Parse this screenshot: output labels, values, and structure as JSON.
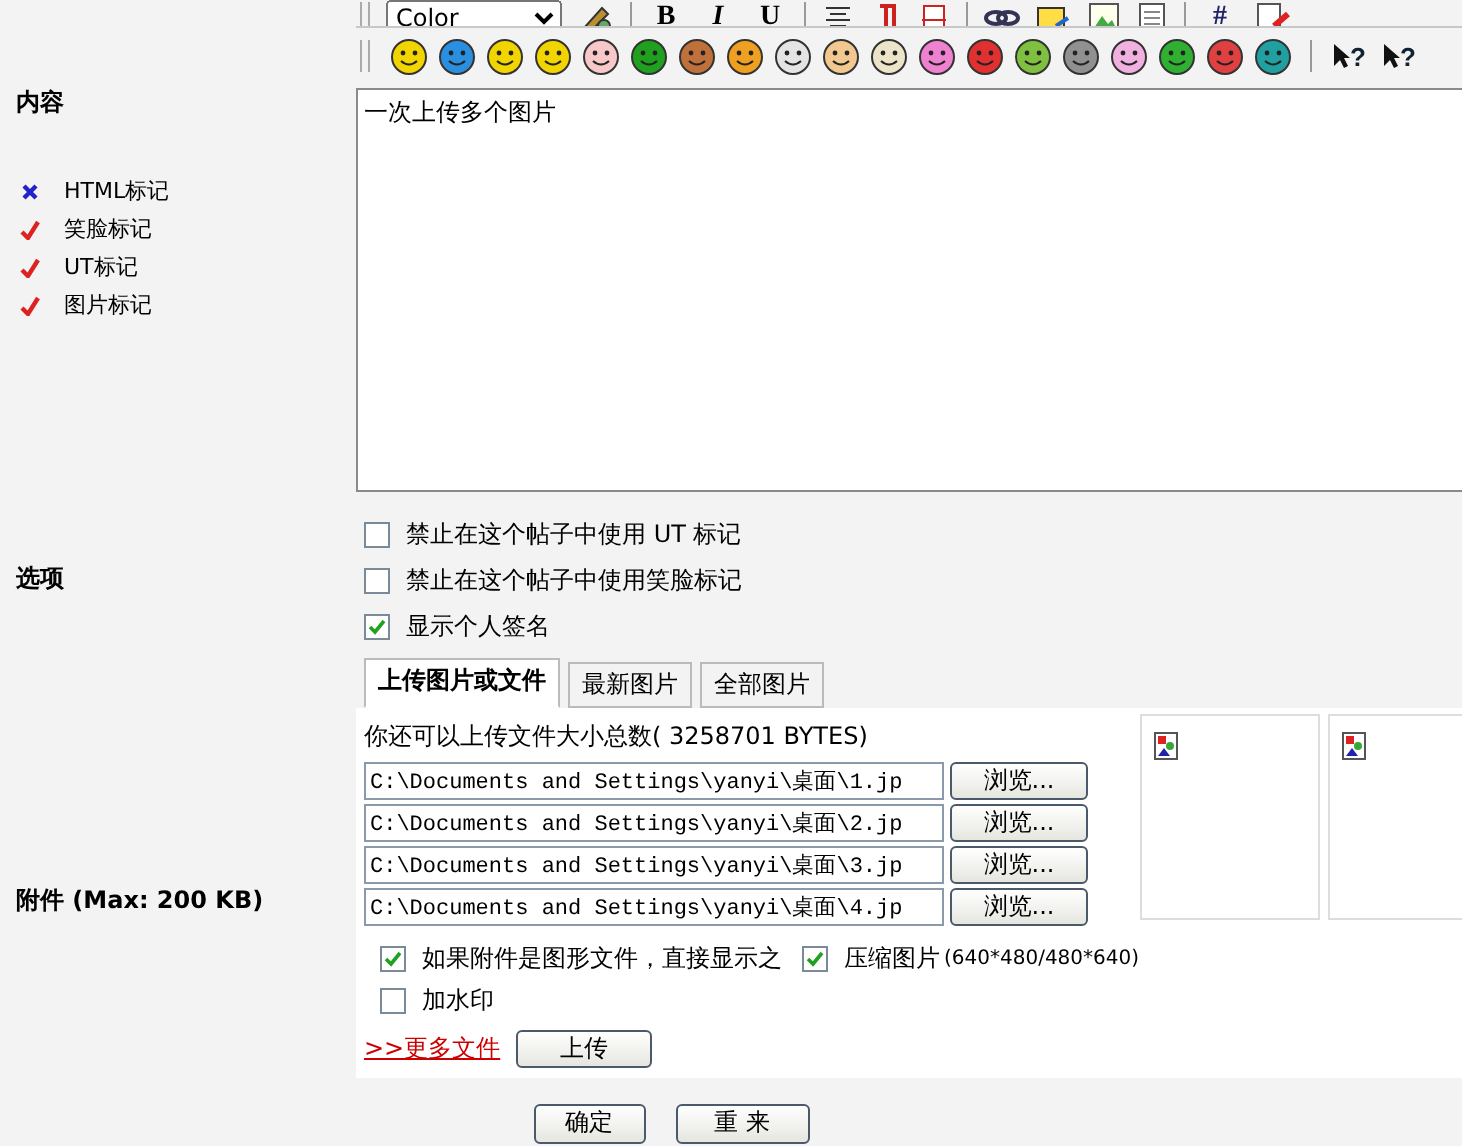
{
  "format_toolbar": {
    "color_select": "Color",
    "text_buttons": [
      "B",
      "I",
      "U"
    ],
    "hash_button": "#"
  },
  "emoticons": [
    {
      "color": "#f2d400"
    },
    {
      "color": "#2a8fe0"
    },
    {
      "color": "#f2d400"
    },
    {
      "color": "#f2d400"
    },
    {
      "color": "#f8c8c8"
    },
    {
      "color": "#1fa01f"
    },
    {
      "color": "#c0703a"
    },
    {
      "color": "#f0a020"
    },
    {
      "color": "#e4e4e4"
    },
    {
      "color": "#f2c890"
    },
    {
      "color": "#ece4c8"
    },
    {
      "color": "#f080d0"
    },
    {
      "color": "#e03030"
    },
    {
      "color": "#80c040"
    },
    {
      "color": "#909090"
    },
    {
      "color": "#f0b0e0"
    },
    {
      "color": "#30b030"
    },
    {
      "color": "#e04040"
    },
    {
      "color": "#20a0a0"
    }
  ],
  "help_buttons": [
    "?",
    "?"
  ],
  "content": {
    "label": "内容",
    "value": "一次上传多个图片",
    "markup_flags": [
      {
        "label": "HTML标记",
        "enabled": false
      },
      {
        "label": "笑脸标记",
        "enabled": true
      },
      {
        "label": "UT标记",
        "enabled": true
      },
      {
        "label": "图片标记",
        "enabled": true
      }
    ]
  },
  "options": {
    "label": "选项",
    "items": [
      {
        "label": "禁止在这个帖子中使用 UT 标记",
        "checked": false
      },
      {
        "label": "禁止在这个帖子中使用笑脸标记",
        "checked": false
      },
      {
        "label": "显示个人签名",
        "checked": true
      }
    ]
  },
  "attachments": {
    "label": "附件 (Max: 200 KB)",
    "tabs": [
      {
        "label": "上传图片或文件",
        "selected": true
      },
      {
        "label": "最新图片",
        "selected": false
      },
      {
        "label": "全部图片",
        "selected": false
      }
    ],
    "quota": "你还可以上传文件大小总数( 3258701 BYTES)",
    "files": [
      {
        "value": "C:\\Documents and Settings\\yanyi\\桌面\\1.jp",
        "browse": "浏览..."
      },
      {
        "value": "C:\\Documents and Settings\\yanyi\\桌面\\2.jp",
        "browse": "浏览..."
      },
      {
        "value": "C:\\Documents and Settings\\yanyi\\桌面\\3.jp",
        "browse": "浏览..."
      },
      {
        "value": "C:\\Documents and Settings\\yanyi\\桌面\\4.jp",
        "browse": "浏览..."
      }
    ],
    "previews": [
      {
        "kind": "broken-image"
      },
      {
        "kind": "broken-image"
      }
    ],
    "show_inline": {
      "label": "如果附件是图形文件，直接显示之",
      "checked": true
    },
    "compress": {
      "label": "压缩图片",
      "note": "(640*480/480*640)",
      "checked": true
    },
    "watermark": {
      "label": "加水印",
      "checked": false
    },
    "more_link": ">>更多文件",
    "upload_button": "上传"
  },
  "buttons": [
    "确定",
    "重 来"
  ]
}
